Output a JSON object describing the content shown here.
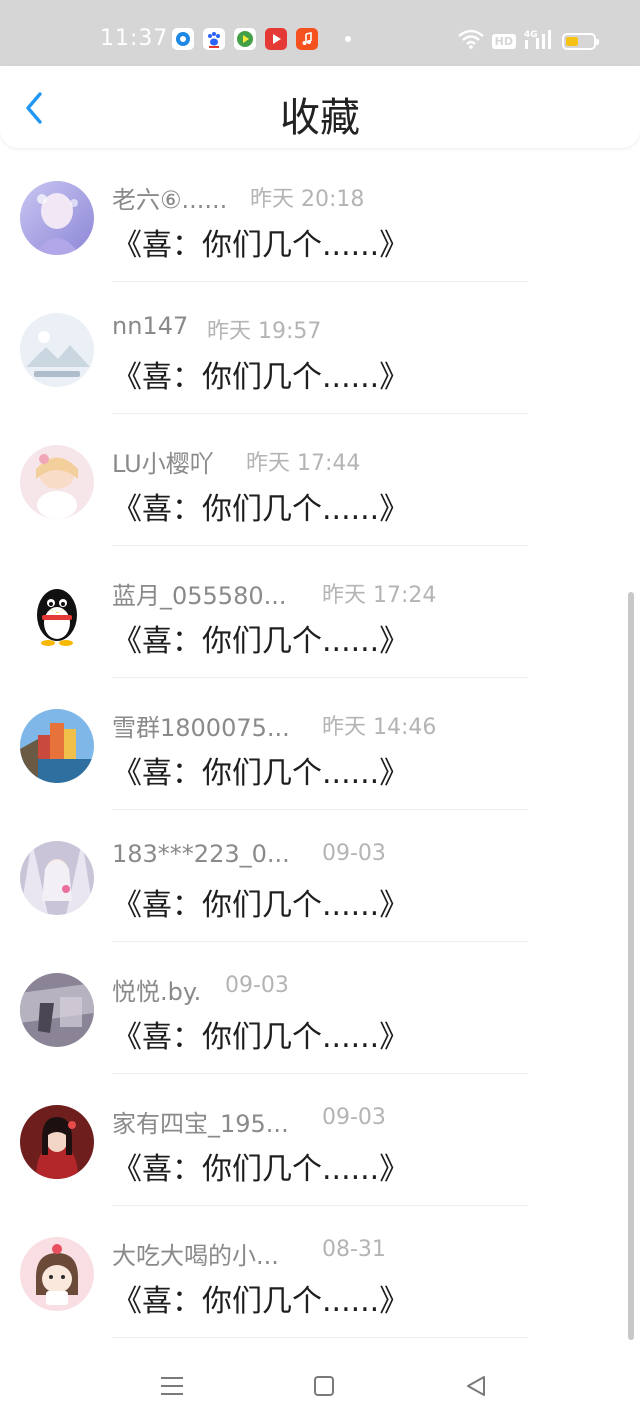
{
  "status_bar": {
    "time": "11:37",
    "apps": [
      "browser-icon",
      "baidu-icon",
      "video-player-icon",
      "video-icon",
      "music-icon"
    ],
    "hd": "HD",
    "network": "4G",
    "battery_level": 0.45
  },
  "header": {
    "title": "收藏",
    "back_icon": "chevron-left-icon"
  },
  "favorites": [
    {
      "name": "老六⑥......",
      "time": "昨天 20:18",
      "content": "《喜：你们几个......》",
      "avatar": "avatar-anime-purple"
    },
    {
      "name": "nn147",
      "time": "昨天 19:57",
      "content": "《喜：你们几个......》",
      "avatar": "avatar-placeholder"
    },
    {
      "name": "LU小樱吖",
      "time": "昨天 17:44",
      "content": "《喜：你们几个......》",
      "avatar": "avatar-anime-pink"
    },
    {
      "name": "蓝月_055580...",
      "time": "昨天 17:24",
      "content": "《喜：你们几个......》",
      "avatar": "avatar-qq-penguin"
    },
    {
      "name": "雪群1800075...",
      "time": "昨天 14:46",
      "content": "《喜：你们几个......》",
      "avatar": "avatar-coastal-town"
    },
    {
      "name": "183***223_0...",
      "time": "09-03",
      "content": "《喜：你们几个......》",
      "avatar": "avatar-anime-white"
    },
    {
      "name": "悦悦.by.",
      "time": "09-03",
      "content": "《喜：你们几个......》",
      "avatar": "avatar-gray-photo"
    },
    {
      "name": "家有四宝_195...",
      "time": "09-03",
      "content": "《喜：你们几个......》",
      "avatar": "avatar-girl-red"
    },
    {
      "name": "大吃大喝的小...",
      "time": "08-31",
      "content": "《喜：你们几个......》",
      "avatar": "avatar-cartoon-girl"
    }
  ],
  "nav_bar": {
    "menu_icon": "menu-icon",
    "home_icon": "home-square-icon",
    "back_icon": "back-triangle-icon"
  },
  "colors": {
    "status_bar_bg": "#d6d6d6",
    "accent": "#2196f3",
    "name_text": "#8a8a8a",
    "time_text": "#b4b4b4",
    "battery": "#f7c216"
  }
}
